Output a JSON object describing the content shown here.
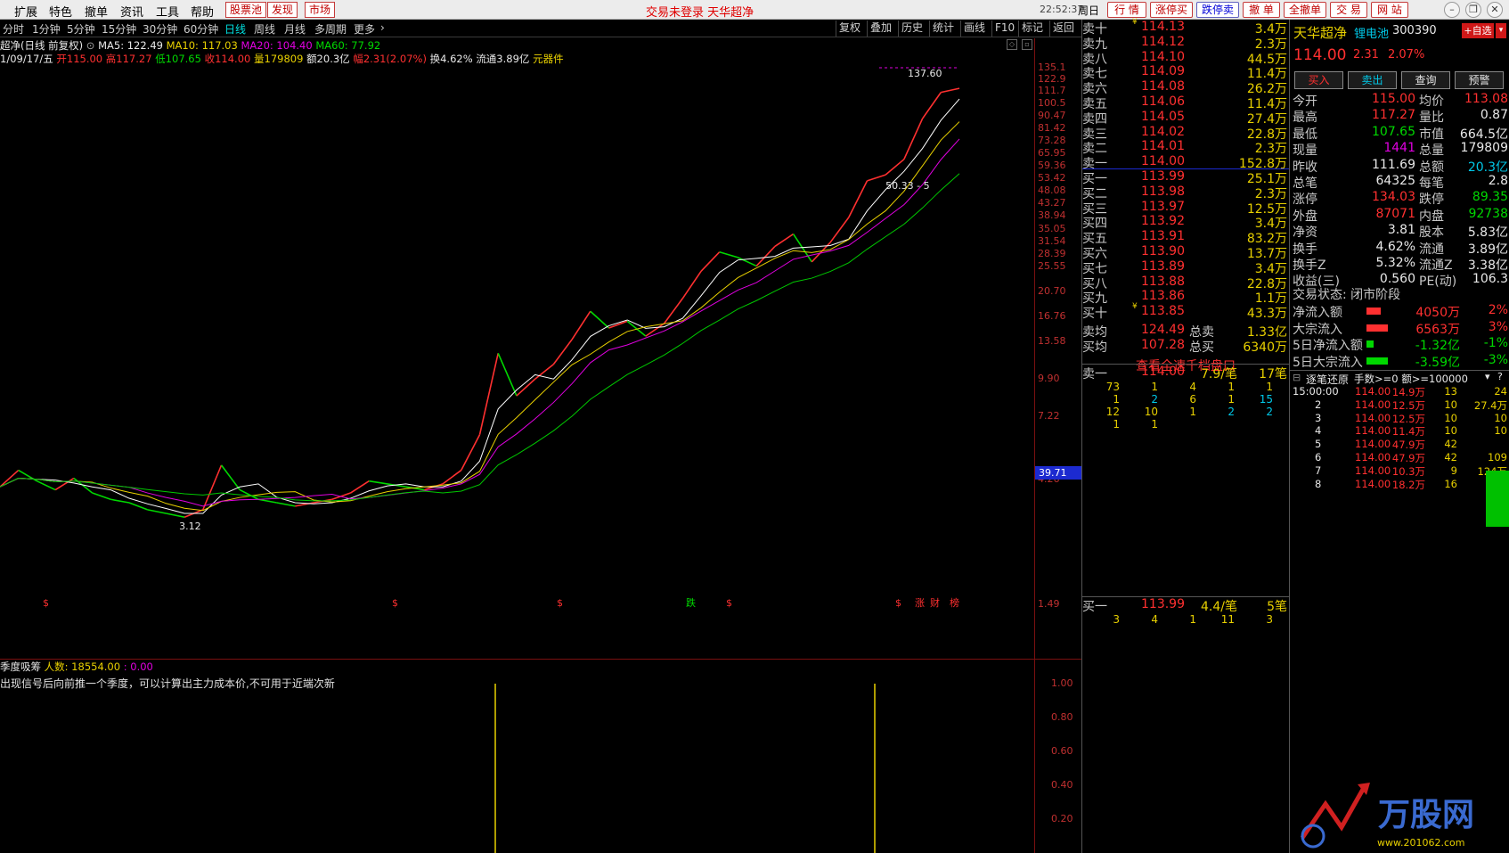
{
  "menu": {
    "items": [
      "扩展",
      "特色",
      "撤单",
      "资讯",
      "工具",
      "帮助"
    ],
    "boxed": [
      "股票池",
      "发现",
      "市场"
    ],
    "notice": "交易未登录  天华超净",
    "clock": "22:52:37",
    "day": "周日",
    "right_buttons": [
      "行 情",
      "涨停买",
      "跌停卖",
      "撤 单",
      "全撤单",
      "交 易",
      "网 站"
    ]
  },
  "periods": [
    "分时",
    "1分钟",
    "5分钟",
    "15分钟",
    "30分钟",
    "60分钟",
    "日线",
    "周线",
    "月线",
    "多周期",
    "更多"
  ],
  "active_period": "日线",
  "tools": [
    "复权",
    "叠加",
    "历史",
    "统计",
    "画线",
    "F10",
    "标记",
    "返回"
  ],
  "info": {
    "name": "超净(日线 前复权)",
    "ma5": "MA5: 122.49",
    "ma10": "MA10: 117.03",
    "ma20": "MA20: 104.40",
    "ma60": "MA60: 77.92",
    "date": "1/09/17/五",
    "open": "开115.00",
    "high": "高117.27",
    "low": "低107.65",
    "close": "收114.00",
    "vol": "量179809",
    "amt": "额20.3亿",
    "chg": "幅2.31(2.07%)",
    "turnover": "换4.62%",
    "float": "流通3.89亿",
    "sector": "元器件"
  },
  "chart_data": {
    "type": "line",
    "title": "天华超净 日线 前复权",
    "y_ticks": [
      "135.1",
      "122.9",
      "111.7",
      "100.5",
      "90.47",
      "81.42",
      "73.28",
      "65.95",
      "59.36",
      "53.42",
      "48.08",
      "43.27",
      "38.94",
      "35.05",
      "31.54",
      "28.39",
      "25.55",
      "20.70",
      "16.76",
      "13.58",
      "9.90",
      "7.22",
      "4.26",
      "1.49"
    ],
    "ylim": [
      1.49,
      137.6
    ],
    "y_scale": "log",
    "current_price": "39.71",
    "annotations": [
      "137.60",
      "50.33 - 5",
      "3.12"
    ],
    "markers": [
      "$",
      "$",
      "$",
      "跌",
      "$",
      "$",
      "涨",
      "财",
      "榜"
    ],
    "close_series": [
      4.0,
      4.6,
      4.2,
      3.9,
      4.3,
      3.8,
      3.6,
      3.5,
      3.3,
      3.2,
      3.1,
      3.3,
      4.8,
      3.9,
      3.6,
      3.5,
      3.4,
      3.5,
      3.6,
      3.8,
      4.2,
      4.1,
      4.0,
      3.9,
      4.1,
      4.6,
      6.2,
      12.3,
      8.6,
      9.9,
      11.2,
      13.8,
      17.5,
      15.2,
      16.1,
      14.2,
      15.8,
      19.5,
      24.5,
      28.8,
      27.5,
      25.6,
      30.2,
      33.5,
      26.5,
      31.2,
      38.5,
      52.4,
      55.1,
      62.8,
      88.4,
      110.2,
      114.0
    ]
  },
  "indicator": {
    "name": "季度吸筹",
    "count_label": "人数: 18554.00",
    "value": ": 0.00",
    "note": "出现信号后向前推一个季度，可以计算出主力成本价,不可用于近端次新",
    "y_ticks": [
      "1.00",
      "0.80",
      "0.60",
      "0.40",
      "0.20"
    ],
    "signals": [
      1,
      1
    ]
  },
  "orderbook": {
    "asks": [
      {
        "label": "卖十",
        "price": "114.13",
        "vol": "3.4万",
        "mark": "¥"
      },
      {
        "label": "卖九",
        "price": "114.12",
        "vol": "2.3万"
      },
      {
        "label": "卖八",
        "price": "114.10",
        "vol": "44.5万"
      },
      {
        "label": "卖七",
        "price": "114.09",
        "vol": "11.4万"
      },
      {
        "label": "卖六",
        "price": "114.08",
        "vol": "26.2万"
      },
      {
        "label": "卖五",
        "price": "114.06",
        "vol": "11.4万"
      },
      {
        "label": "卖四",
        "price": "114.05",
        "vol": "27.4万"
      },
      {
        "label": "卖三",
        "price": "114.02",
        "vol": "22.8万"
      },
      {
        "label": "卖二",
        "price": "114.01",
        "vol": "2.3万"
      },
      {
        "label": "卖一",
        "price": "114.00",
        "vol": "152.8万"
      }
    ],
    "bids": [
      {
        "label": "买一",
        "price": "113.99",
        "vol": "25.1万"
      },
      {
        "label": "买二",
        "price": "113.98",
        "vol": "2.3万"
      },
      {
        "label": "买三",
        "price": "113.97",
        "vol": "12.5万"
      },
      {
        "label": "买四",
        "price": "113.92",
        "vol": "3.4万"
      },
      {
        "label": "买五",
        "price": "113.91",
        "vol": "83.2万"
      },
      {
        "label": "买六",
        "price": "113.90",
        "vol": "13.7万"
      },
      {
        "label": "买七",
        "price": "113.89",
        "vol": "3.4万"
      },
      {
        "label": "买八",
        "price": "113.88",
        "vol": "22.8万"
      },
      {
        "label": "买九",
        "price": "113.86",
        "vol": "1.1万"
      },
      {
        "label": "买十",
        "price": "113.85",
        "vol": "43.3万",
        "mark": "¥"
      }
    ],
    "avg_ask": {
      "label": "卖均",
      "price": "124.49",
      "tlabel": "总卖",
      "total": "1.33亿"
    },
    "avg_bid": {
      "label": "买均",
      "price": "107.28",
      "tlabel": "总买",
      "total": "6340万"
    },
    "link": "查看全速千档盘口",
    "sell1": {
      "label": "卖一",
      "price": "114.00",
      "per": "7.9/笔",
      "count": "17笔"
    },
    "sell1_queue": [
      [
        "73",
        "1",
        "4",
        "1",
        "1"
      ],
      [
        "1",
        "2",
        "6",
        "1",
        "15"
      ],
      [
        "12",
        "10",
        "1",
        "2",
        "2"
      ],
      [
        "1",
        "1",
        "",
        "",
        ""
      ]
    ],
    "buy1": {
      "label": "买一",
      "price": "113.99",
      "per": "4.4/笔",
      "count": "5笔"
    },
    "buy1_queue": [
      [
        "3",
        "4",
        "1",
        "11",
        "3"
      ]
    ]
  },
  "quote": {
    "name": "天华超净",
    "sector": "锂电池",
    "code": "300390",
    "add_btn": "+自选",
    "price": "114.00",
    "change": "2.31",
    "pct": "2.07%",
    "buttons": [
      "买入",
      "卖出",
      "查询",
      "预警"
    ],
    "rows": [
      [
        "今开",
        "115.00",
        "均价",
        "113.08"
      ],
      [
        "最高",
        "117.27",
        "量比",
        "0.87"
      ],
      [
        "最低",
        "107.65",
        "市值",
        "664.5亿"
      ],
      [
        "现量",
        "1441",
        "总量",
        "179809"
      ],
      [
        "昨收",
        "111.69",
        "总额",
        "20.3亿"
      ],
      [
        "总笔",
        "64325",
        "每笔",
        "2.8"
      ],
      [
        "涨停",
        "134.03",
        "跌停",
        "89.35"
      ],
      [
        "外盘",
        "87071",
        "内盘",
        "92738"
      ],
      [
        "净资",
        "3.81",
        "股本",
        "5.83亿"
      ],
      [
        "换手",
        "4.62%",
        "流通",
        "3.89亿"
      ],
      [
        "换手Z",
        "5.32%",
        "流通Z",
        "3.38亿"
      ],
      [
        "收益(三)",
        "0.560",
        "PE(动)",
        "106.3"
      ]
    ],
    "state": "交易状态: 闭市阶段",
    "flows": [
      {
        "label": "净流入额",
        "value": "4050万",
        "pct": "2%"
      },
      {
        "label": "大宗流入",
        "value": "6563万",
        "pct": "3%"
      },
      {
        "label": "5日净流入额",
        "value": "-1.32亿",
        "pct": "-1%"
      },
      {
        "label": "5日大宗流入",
        "value": "-3.59亿",
        "pct": "-3%"
      }
    ]
  },
  "ticks": {
    "title": "逐笔还原",
    "filter": "手数>=0 额>=100000",
    "rows": [
      {
        "i": "15:00:00",
        "p": "114.00",
        "v": "14.9万",
        "n": "13",
        "x": "24"
      },
      {
        "i": "2",
        "p": "114.00",
        "v": "12.5万",
        "n": "10",
        "x": "27.4万"
      },
      {
        "i": "3",
        "p": "114.00",
        "v": "12.5万",
        "n": "10",
        "x": "10"
      },
      {
        "i": "4",
        "p": "114.00",
        "v": "11.4万",
        "n": "10",
        "x": "10"
      },
      {
        "i": "5",
        "p": "114.00",
        "v": "47.9万",
        "n": "42",
        "x": ""
      },
      {
        "i": "6",
        "p": "114.00",
        "v": "47.9万",
        "n": "42",
        "x": "109"
      },
      {
        "i": "7",
        "p": "114.00",
        "v": "10.3万",
        "n": "9",
        "x": "124万"
      },
      {
        "i": "8",
        "p": "114.00",
        "v": "18.2万",
        "n": "16",
        "x": ""
      }
    ]
  },
  "watermark": {
    "brand": "万股网",
    "url": "www.201062.com"
  },
  "colors": {
    "up": "#ff3030",
    "down": "#00d800",
    "ma5": "#ffffff",
    "ma10": "#e8d000",
    "ma20": "#e000e0",
    "ma60": "#00c800",
    "bg": "#000000"
  }
}
